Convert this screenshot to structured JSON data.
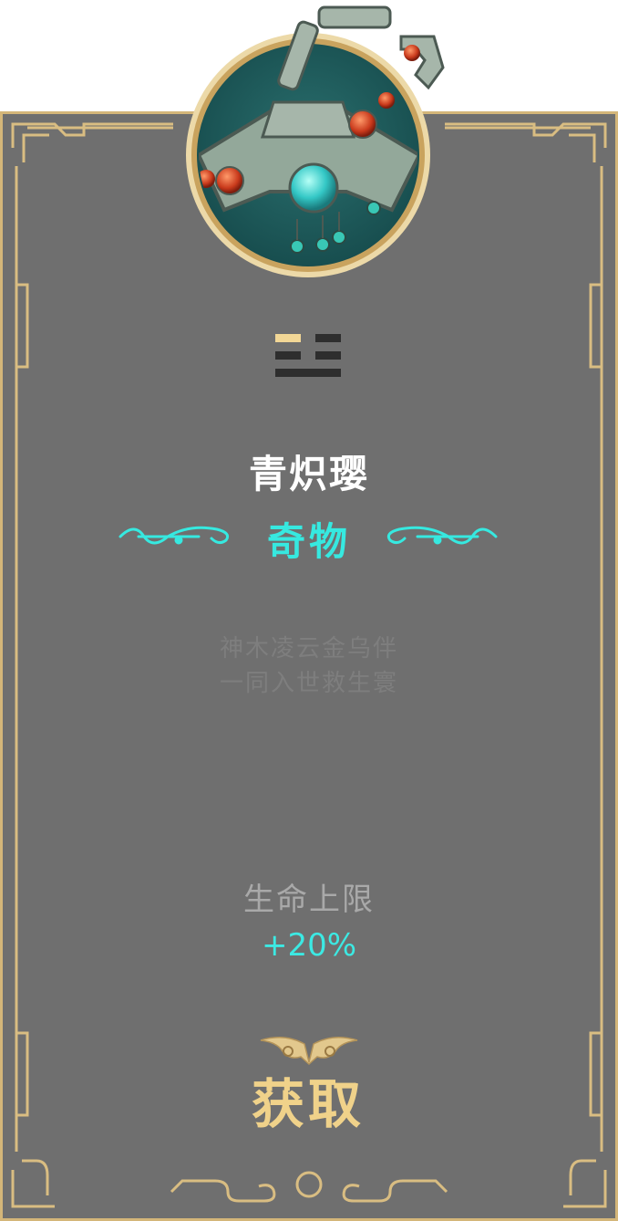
{
  "item": {
    "name": "青炽璎",
    "type": "奇物",
    "flavor_line1": "神木凌云金乌伴",
    "flavor_line2": "一同入世救生寰",
    "icon": "jade-necklace-icon"
  },
  "stat": {
    "label": "生命上限",
    "value": "+20%"
  },
  "action": {
    "acquire_label": "获取"
  },
  "colors": {
    "card_bg": "#6f6f6f",
    "gold": "#d4b679",
    "cyan": "#36e9e0",
    "name": "#ffffff"
  }
}
